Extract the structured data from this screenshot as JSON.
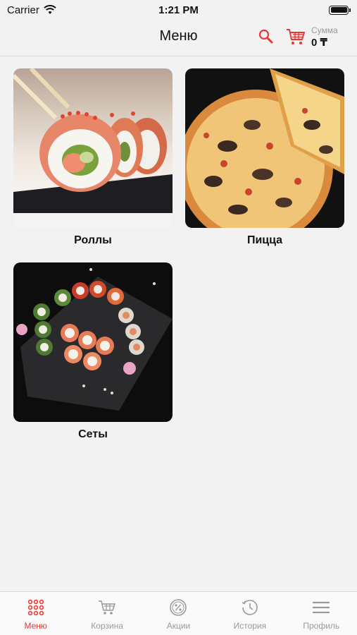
{
  "status_bar": {
    "carrier": "Carrier",
    "time": "1:21 PM"
  },
  "nav": {
    "title": "Меню",
    "sum_label": "Сумма",
    "sum_value": "0 ₸"
  },
  "categories": [
    {
      "label": "Роллы",
      "image": "rolls-photo"
    },
    {
      "label": "Пицца",
      "image": "pizza-photo"
    },
    {
      "label": "Сеты",
      "image": "sets-photo"
    }
  ],
  "tab_bar": {
    "active": "Меню",
    "tabs": [
      {
        "label": "Меню",
        "icon": "grid-dots-icon"
      },
      {
        "label": "Корзина",
        "icon": "cart-icon"
      },
      {
        "label": "Акции",
        "icon": "percent-badge-icon"
      },
      {
        "label": "История",
        "icon": "history-icon"
      },
      {
        "label": "Профиль",
        "icon": "menu-lines-icon"
      }
    ]
  },
  "colors": {
    "accent": "#e53935",
    "inactive": "#9a9a9a",
    "background": "#f2f2f2"
  }
}
